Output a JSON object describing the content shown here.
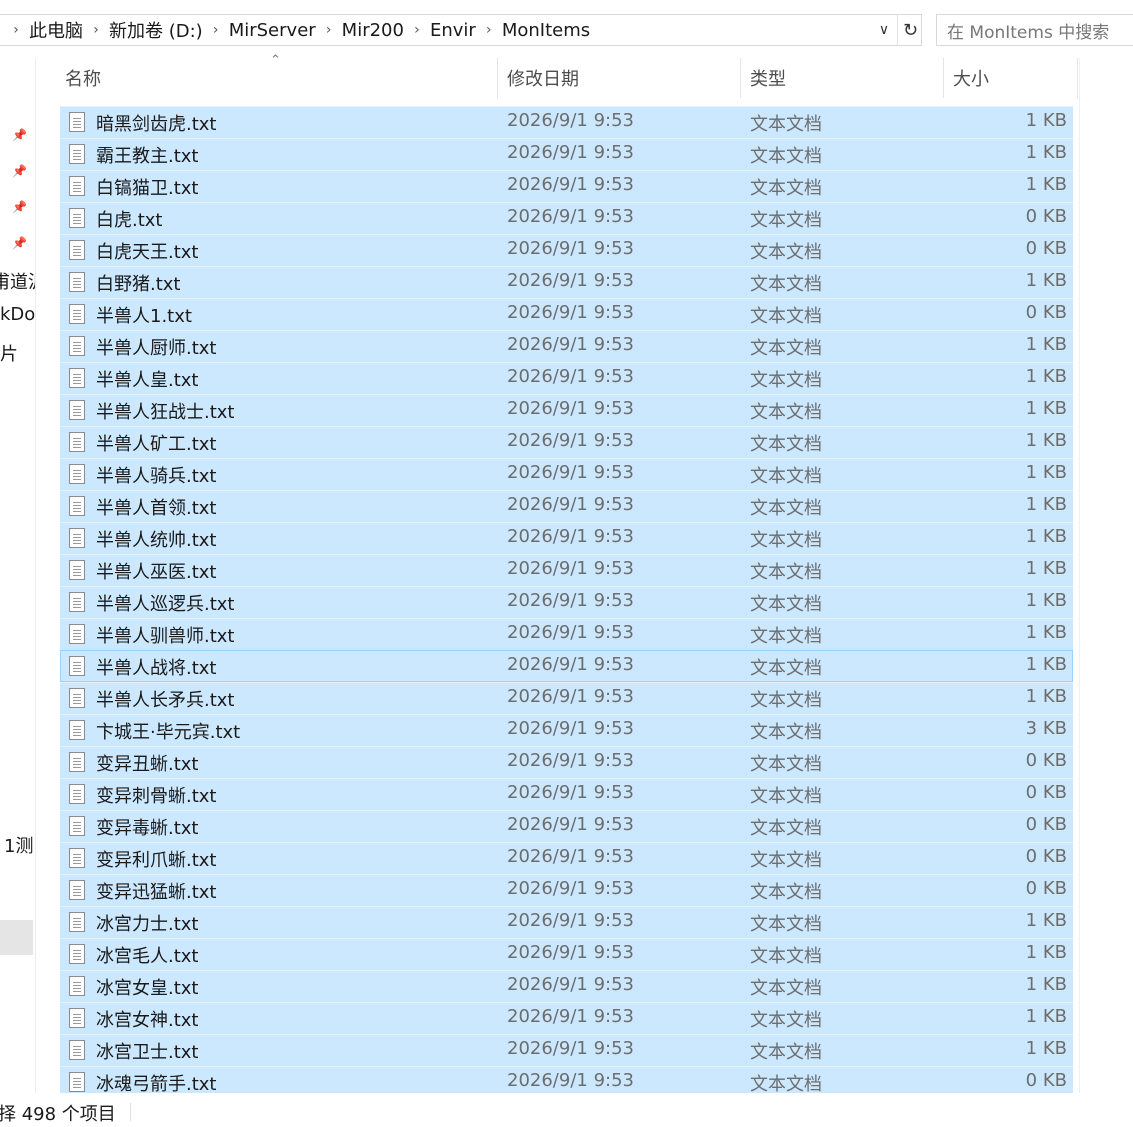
{
  "address": {
    "crumbs": [
      "此电脑",
      "新加卷 (D:)",
      "MirServer",
      "Mir200",
      "Envir",
      "MonItems"
    ],
    "separator": "›",
    "dropdown_icon": "chevron-down-icon",
    "refresh_icon": "refresh-icon"
  },
  "search": {
    "placeholder": "在 MonItems 中搜索"
  },
  "nav": {
    "fragments": [
      "甫道沪",
      "kDo",
      "片",
      "1测"
    ]
  },
  "columns": {
    "name": "名称",
    "date": "修改日期",
    "type": "类型",
    "size": "大小"
  },
  "files": [
    {
      "name": "暗黑剑齿虎.txt",
      "date": "2026/9/1 9:53",
      "type": "文本文档",
      "size": "1 KB"
    },
    {
      "name": "霸王教主.txt",
      "date": "2026/9/1 9:53",
      "type": "文本文档",
      "size": "1 KB"
    },
    {
      "name": "白镐猫卫.txt",
      "date": "2026/9/1 9:53",
      "type": "文本文档",
      "size": "1 KB"
    },
    {
      "name": "白虎.txt",
      "date": "2026/9/1 9:53",
      "type": "文本文档",
      "size": "0 KB"
    },
    {
      "name": "白虎天王.txt",
      "date": "2026/9/1 9:53",
      "type": "文本文档",
      "size": "0 KB"
    },
    {
      "name": "白野猪.txt",
      "date": "2026/9/1 9:53",
      "type": "文本文档",
      "size": "1 KB"
    },
    {
      "name": "半兽人1.txt",
      "date": "2026/9/1 9:53",
      "type": "文本文档",
      "size": "0 KB"
    },
    {
      "name": "半兽人厨师.txt",
      "date": "2026/9/1 9:53",
      "type": "文本文档",
      "size": "1 KB"
    },
    {
      "name": "半兽人皇.txt",
      "date": "2026/9/1 9:53",
      "type": "文本文档",
      "size": "1 KB"
    },
    {
      "name": "半兽人狂战士.txt",
      "date": "2026/9/1 9:53",
      "type": "文本文档",
      "size": "1 KB"
    },
    {
      "name": "半兽人矿工.txt",
      "date": "2026/9/1 9:53",
      "type": "文本文档",
      "size": "1 KB"
    },
    {
      "name": "半兽人骑兵.txt",
      "date": "2026/9/1 9:53",
      "type": "文本文档",
      "size": "1 KB"
    },
    {
      "name": "半兽人首领.txt",
      "date": "2026/9/1 9:53",
      "type": "文本文档",
      "size": "1 KB"
    },
    {
      "name": "半兽人统帅.txt",
      "date": "2026/9/1 9:53",
      "type": "文本文档",
      "size": "1 KB"
    },
    {
      "name": "半兽人巫医.txt",
      "date": "2026/9/1 9:53",
      "type": "文本文档",
      "size": "1 KB"
    },
    {
      "name": "半兽人巡逻兵.txt",
      "date": "2026/9/1 9:53",
      "type": "文本文档",
      "size": "1 KB"
    },
    {
      "name": "半兽人驯兽师.txt",
      "date": "2026/9/1 9:53",
      "type": "文本文档",
      "size": "1 KB"
    },
    {
      "name": "半兽人战将.txt",
      "date": "2026/9/1 9:53",
      "type": "文本文档",
      "size": "1 KB"
    },
    {
      "name": "半兽人长矛兵.txt",
      "date": "2026/9/1 9:53",
      "type": "文本文档",
      "size": "1 KB"
    },
    {
      "name": "卞城王·毕元宾.txt",
      "date": "2026/9/1 9:53",
      "type": "文本文档",
      "size": "3 KB"
    },
    {
      "name": "变异丑蜥.txt",
      "date": "2026/9/1 9:53",
      "type": "文本文档",
      "size": "0 KB"
    },
    {
      "name": "变异刺骨蜥.txt",
      "date": "2026/9/1 9:53",
      "type": "文本文档",
      "size": "0 KB"
    },
    {
      "name": "变异毒蜥.txt",
      "date": "2026/9/1 9:53",
      "type": "文本文档",
      "size": "0 KB"
    },
    {
      "name": "变异利爪蜥.txt",
      "date": "2026/9/1 9:53",
      "type": "文本文档",
      "size": "0 KB"
    },
    {
      "name": "变异迅猛蜥.txt",
      "date": "2026/9/1 9:53",
      "type": "文本文档",
      "size": "0 KB"
    },
    {
      "name": "冰宫力士.txt",
      "date": "2026/9/1 9:53",
      "type": "文本文档",
      "size": "1 KB"
    },
    {
      "name": "冰宫毛人.txt",
      "date": "2026/9/1 9:53",
      "type": "文本文档",
      "size": "1 KB"
    },
    {
      "name": "冰宫女皇.txt",
      "date": "2026/9/1 9:53",
      "type": "文本文档",
      "size": "1 KB"
    },
    {
      "name": "冰宫女神.txt",
      "date": "2026/9/1 9:53",
      "type": "文本文档",
      "size": "1 KB"
    },
    {
      "name": "冰宫卫士.txt",
      "date": "2026/9/1 9:53",
      "type": "文本文档",
      "size": "1 KB"
    },
    {
      "name": "冰魂弓箭手.txt",
      "date": "2026/9/1 9:53",
      "type": "文本文档",
      "size": "0 KB"
    }
  ],
  "focused_index": 17,
  "selection_color": "#cce8ff",
  "status": {
    "text": "择 498 个项目"
  }
}
